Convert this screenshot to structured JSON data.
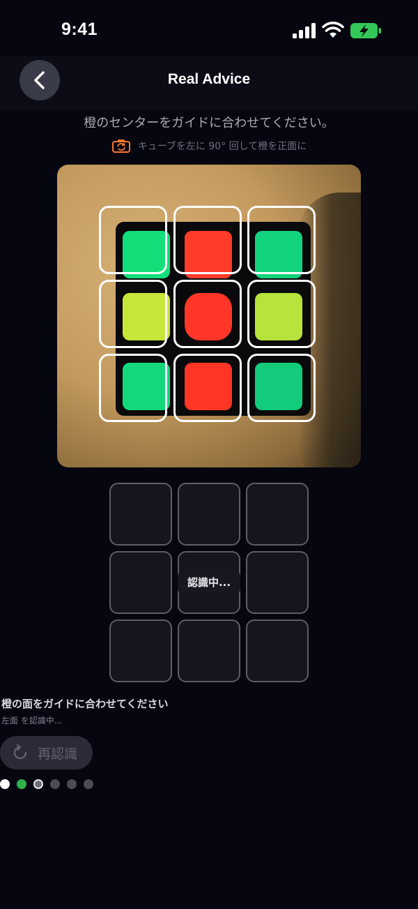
{
  "status": {
    "time": "9:41",
    "battery_color": "#34c759"
  },
  "header": {
    "title": "Real Advice",
    "back_icon": "chevron-left-icon"
  },
  "instruction": "橙のセンターをガイドに合わせてください。",
  "sub_instruction": {
    "icon": "rotate-camera-icon",
    "text": "キューブを左に 90° 回して橙を正面に"
  },
  "camera": {
    "stickers": [
      [
        "#12df7a",
        "#ff3b2a",
        "#12d47c"
      ],
      [
        "#c6e63a",
        "#ff3628",
        "#b6e33c"
      ],
      [
        "#14d97c",
        "#ff3626",
        "#12cc7c"
      ]
    ]
  },
  "preview": {
    "status_text": "認識中..."
  },
  "bottom": {
    "title": "橙の面をガイドに合わせてください",
    "subtitle": "左面 を認識中...",
    "retry_label": "再認識",
    "retry_icon": "refresh-icon"
  },
  "progress_dots": [
    {
      "state": "done",
      "color": "#ffffff"
    },
    {
      "state": "done",
      "color": "#2fb24b"
    },
    {
      "state": "current",
      "color": "#6e6f7a"
    },
    {
      "state": "pending",
      "color": "#4a4b56"
    },
    {
      "state": "pending",
      "color": "#4a4b56"
    },
    {
      "state": "pending",
      "color": "#4a4b56"
    }
  ]
}
